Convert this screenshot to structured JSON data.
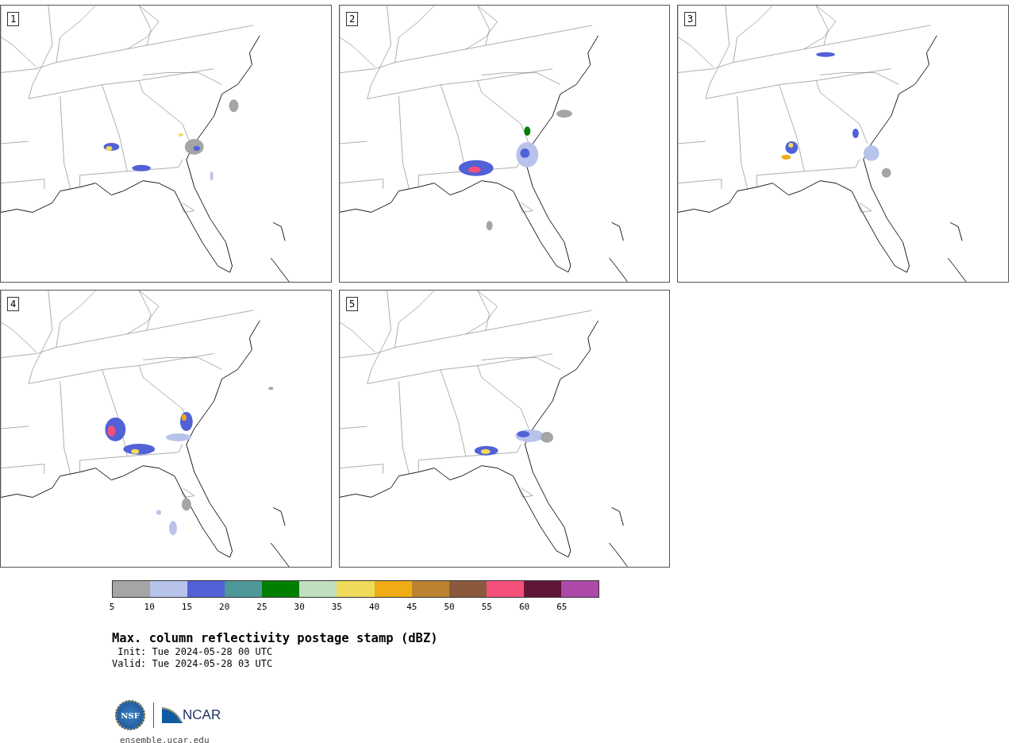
{
  "panels": [
    {
      "label": "1"
    },
    {
      "label": "2"
    },
    {
      "label": "3"
    },
    {
      "label": "4"
    },
    {
      "label": "5"
    }
  ],
  "colorbar": {
    "bins": [
      {
        "color": "#a5a5a5"
      },
      {
        "color": "#b8c3ec"
      },
      {
        "color": "#5161d6"
      },
      {
        "color": "#4d9799"
      },
      {
        "color": "#008000"
      },
      {
        "color": "#bfdfbf"
      },
      {
        "color": "#f0da5c"
      },
      {
        "color": "#f0ac14"
      },
      {
        "color": "#bd8231"
      },
      {
        "color": "#8b5a3d"
      },
      {
        "color": "#f4507c"
      },
      {
        "color": "#601737"
      },
      {
        "color": "#ad4aa8"
      }
    ],
    "ticks": [
      "5",
      "10",
      "15",
      "20",
      "25",
      "30",
      "35",
      "40",
      "45",
      "50",
      "55",
      "60",
      "65"
    ]
  },
  "title": "Max. column reflectivity postage stamp (dBZ)",
  "init": " Init: Tue 2024-05-28 00 UTC",
  "valid": "Valid: Tue 2024-05-28 03 UTC",
  "logo": {
    "nsf": "NSF",
    "ncar": "NCAR"
  },
  "url": "ensemble.ucar.edu"
}
